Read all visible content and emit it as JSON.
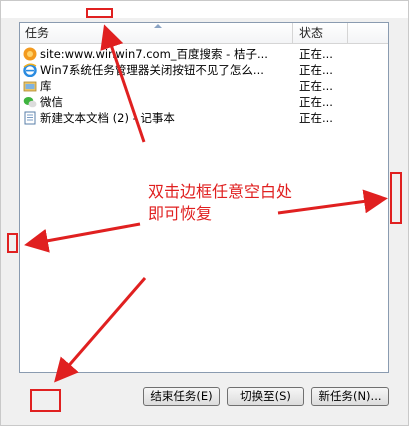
{
  "columns": {
    "task": "任务",
    "status": "状态"
  },
  "rows": [
    {
      "icon": "firefox-orange-icon",
      "task": "site:www.winwin7.com_百度搜索 - 桔子...",
      "status": "正在..."
    },
    {
      "icon": "ie-browser-icon",
      "task": "Win7系统任务管理器关闭按钮不见了怎么...",
      "status": "正在..."
    },
    {
      "icon": "library-folder-icon",
      "task": "库",
      "status": "正在..."
    },
    {
      "icon": "wechat-icon",
      "task": "微信",
      "status": "正在..."
    },
    {
      "icon": "notepad-icon",
      "task": "新建文本文档 (2) - 记事本",
      "status": "正在..."
    }
  ],
  "buttons": {
    "end_task": "结束任务(E)",
    "switch_to": "切换至(S)",
    "new_task": "新任务(N)..."
  },
  "annotation": {
    "line1": "双击边框任意空白处",
    "line2": "即可恢复",
    "color": "#e02020"
  }
}
